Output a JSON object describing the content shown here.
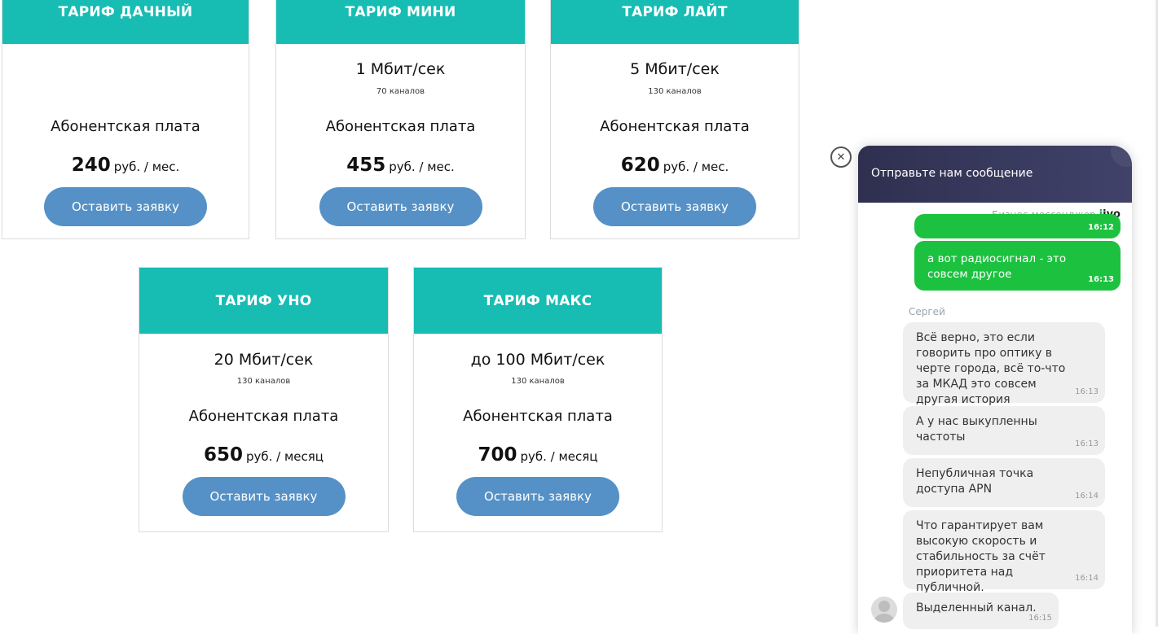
{
  "tariffs": [
    {
      "name": "ТАРИФ ДАЧНЫЙ",
      "speed": "",
      "channels": "",
      "fee_label": "Абонентская плата",
      "price": "240",
      "unit": "руб. / мес.",
      "button": "Оставить заявку"
    },
    {
      "name": "ТАРИФ МИНИ",
      "speed": "1 Мбит/сек",
      "channels": "70 каналов",
      "fee_label": "Абонентская плата",
      "price": "455",
      "unit": "руб. / мес.",
      "button": "Оставить заявку"
    },
    {
      "name": "ТАРИФ ЛАЙТ",
      "speed": "5 Мбит/сек",
      "channels": "130 каналов",
      "fee_label": "Абонентская плата",
      "price": "620",
      "unit": "руб. / мес.",
      "button": "Оставить заявку"
    },
    {
      "name": "ТАРИФ УНО",
      "speed": "20 Мбит/сек",
      "channels": "130 каналов",
      "fee_label": "Абонентская плата",
      "price": "650",
      "unit": "руб. / месяц",
      "button": "Оставить заявку"
    },
    {
      "name": "ТАРИФ МАКС",
      "speed": "до 100 Мбит/сек",
      "channels": "130 каналов",
      "fee_label": "Абонентская плата",
      "price": "700",
      "unit": "руб. / месяц",
      "button": "Оставить заявку"
    }
  ],
  "chat": {
    "close_symbol": "✕",
    "header_title": "Отправьте нам сообщение",
    "brand_text": "Бизнес-мессенджер",
    "brand_logo_j": "j",
    "brand_logo_rest": "ivo",
    "agent_name": "Сергей",
    "outgoing": [
      {
        "text": "",
        "time": "16:12"
      },
      {
        "text": "а вот радиосигнал - это совсем другое",
        "time": "16:13"
      }
    ],
    "incoming": [
      {
        "text": "Всё верно, это если говорить про оптику в черте города, всё то-что за МКАД это совсем другая история",
        "time": "16:13"
      },
      {
        "text": "А у нас выкупленны частоты",
        "time": "16:13"
      },
      {
        "text": "Непубличная точка доступа APN",
        "time": "16:14"
      },
      {
        "text": "Что гарантирует вам высокую скорость и стабильность за счёт приоритета над публичной.",
        "time": "16:14"
      },
      {
        "text": "Выделенный канал.",
        "time": "16:15"
      }
    ]
  }
}
